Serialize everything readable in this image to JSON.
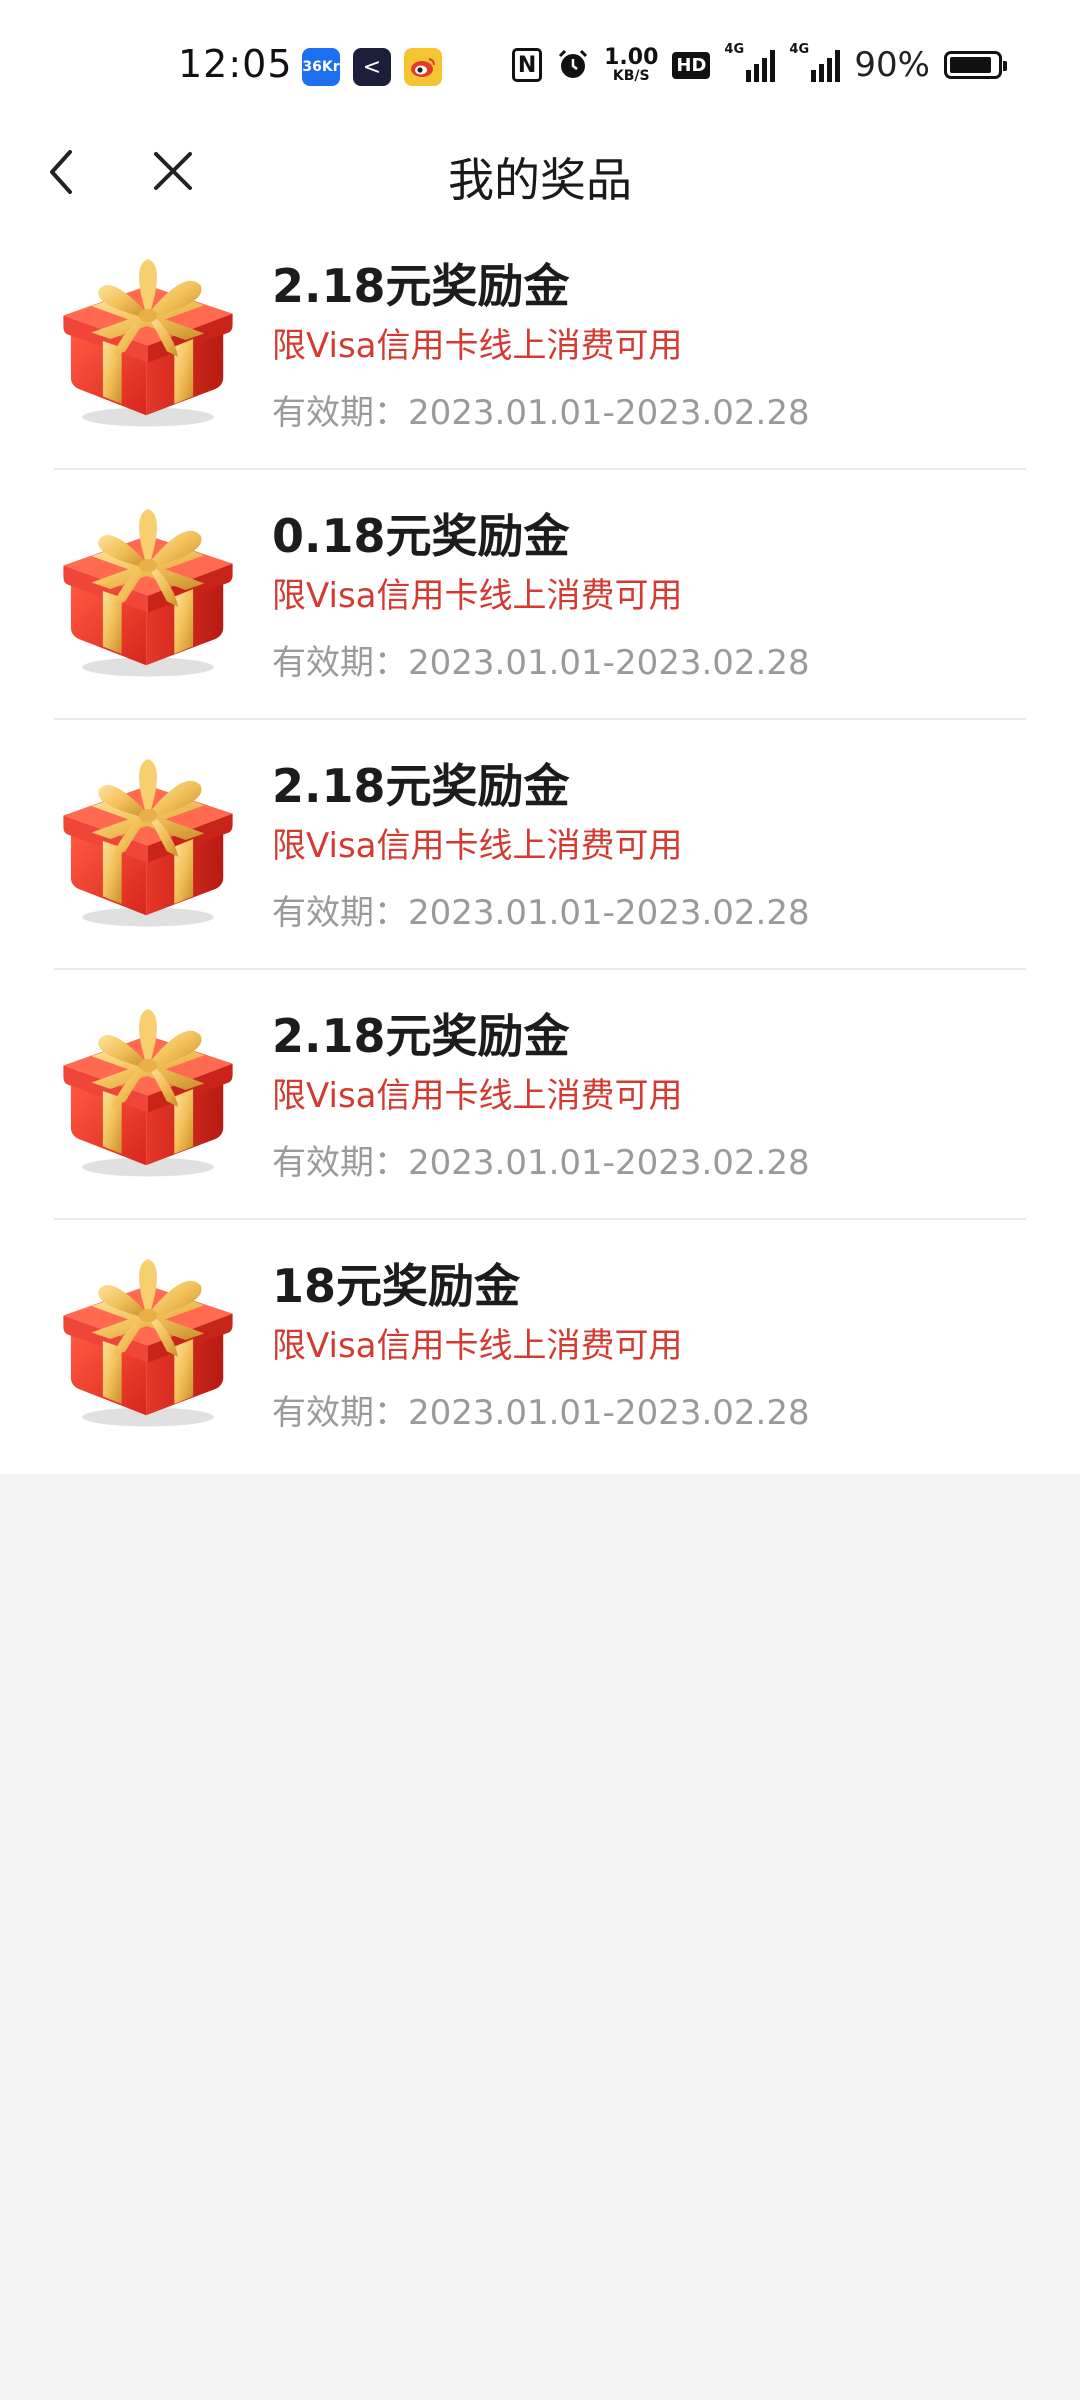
{
  "status_bar": {
    "time": "12:05",
    "apps": [
      {
        "name": "36kr-app-icon",
        "label": "36Kr",
        "color": "#1e6ff0"
      },
      {
        "name": "dark-app-icon",
        "label": "<",
        "color": "#1d1f3a"
      },
      {
        "name": "weibo-app-icon",
        "label": "",
        "color": "#f5c431"
      }
    ],
    "nfc_label": "N",
    "net_speed_value": "1.00",
    "net_speed_unit": "KB/S",
    "hd_label": "HD",
    "signal_label_1": "4G",
    "signal_label_2": "4G",
    "battery_percent": "90%",
    "battery_level": 0.9
  },
  "nav": {
    "title": "我的奖品"
  },
  "colors": {
    "accent_red": "#d33a31",
    "muted_gray": "#9a9a9a",
    "page_bg": "#f3f3f3"
  },
  "prizes": [
    {
      "title": "2.18元奖励金",
      "limit": "限Visa信用卡线上消费可用",
      "validity": "有效期：2023.01.01-2023.02.28",
      "icon": "gift-box-icon"
    },
    {
      "title": "0.18元奖励金",
      "limit": "限Visa信用卡线上消费可用",
      "validity": "有效期：2023.01.01-2023.02.28",
      "icon": "gift-box-icon"
    },
    {
      "title": "2.18元奖励金",
      "limit": "限Visa信用卡线上消费可用",
      "validity": "有效期：2023.01.01-2023.02.28",
      "icon": "gift-box-icon"
    },
    {
      "title": "2.18元奖励金",
      "limit": "限Visa信用卡线上消费可用",
      "validity": "有效期：2023.01.01-2023.02.28",
      "icon": "gift-box-icon"
    },
    {
      "title": "18元奖励金",
      "limit": "限Visa信用卡线上消费可用",
      "validity": "有效期：2023.01.01-2023.02.28",
      "icon": "gift-box-icon"
    }
  ]
}
